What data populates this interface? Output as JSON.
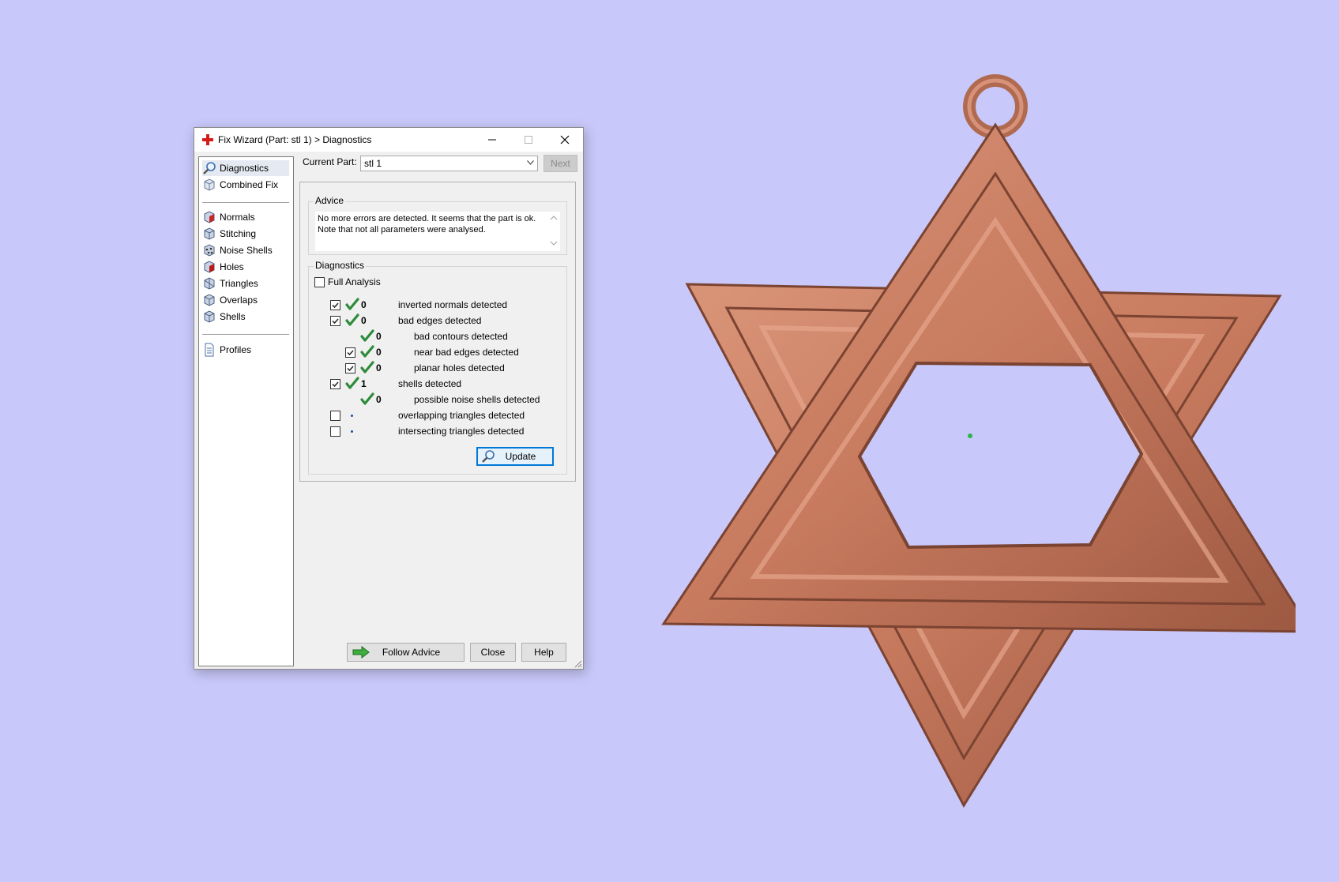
{
  "window": {
    "title": "Fix Wizard (Part: stl 1) > Diagnostics"
  },
  "nav": {
    "items": [
      {
        "label": "Diagnostics",
        "icon": "magnifier-icon"
      },
      {
        "label": "Combined Fix",
        "icon": "cube-icon"
      },
      {
        "label": "Normals",
        "icon": "normals-cube-icon"
      },
      {
        "label": "Stitching",
        "icon": "stitching-cube-icon"
      },
      {
        "label": "Noise Shells",
        "icon": "noise-shells-icon"
      },
      {
        "label": "Holes",
        "icon": "holes-cube-icon"
      },
      {
        "label": "Triangles",
        "icon": "triangles-cube-icon"
      },
      {
        "label": "Overlaps",
        "icon": "overlaps-cube-icon"
      },
      {
        "label": "Shells",
        "icon": "shells-cube-icon"
      },
      {
        "label": "Profiles",
        "icon": "document-icon"
      }
    ]
  },
  "current_part": {
    "label": "Current Part:",
    "value": "stl 1"
  },
  "next_button": "Next",
  "advice": {
    "heading": "Advice",
    "line1": "No more errors are detected. It seems that the part is ok.",
    "line2": "Note that not all parameters were analysed."
  },
  "diagnostics": {
    "heading": "Diagnostics",
    "full_analysis_label": "Full Analysis",
    "full_analysis_checked": false,
    "rows": [
      {
        "checked": true,
        "status": "ok",
        "count": "0",
        "label": "inverted normals detected"
      },
      {
        "checked": true,
        "status": "ok",
        "count": "0",
        "label": "bad edges detected"
      },
      {
        "checked": null,
        "status": "ok",
        "count": "0",
        "label": "bad contours detected"
      },
      {
        "checked": true,
        "status": "ok",
        "count": "0",
        "label": "near bad edges detected"
      },
      {
        "checked": true,
        "status": "ok",
        "count": "0",
        "label": "planar holes detected"
      },
      {
        "checked": true,
        "status": "ok",
        "count": "1",
        "label": "shells detected"
      },
      {
        "checked": null,
        "status": "ok",
        "count": "0",
        "label": "possible noise shells detected"
      },
      {
        "checked": false,
        "status": "not-analysed",
        "count": "",
        "label": "overlapping triangles detected"
      },
      {
        "checked": false,
        "status": "not-analysed",
        "count": "",
        "label": "intersecting triangles detected"
      }
    ]
  },
  "buttons": {
    "update": "Update",
    "follow_advice": "Follow Advice",
    "close": "Close",
    "help": "Help"
  },
  "colors": {
    "background": "#c8c8fa",
    "model": "#c77a5e",
    "check": "#2e8b3a",
    "accent": "#0078d7"
  }
}
